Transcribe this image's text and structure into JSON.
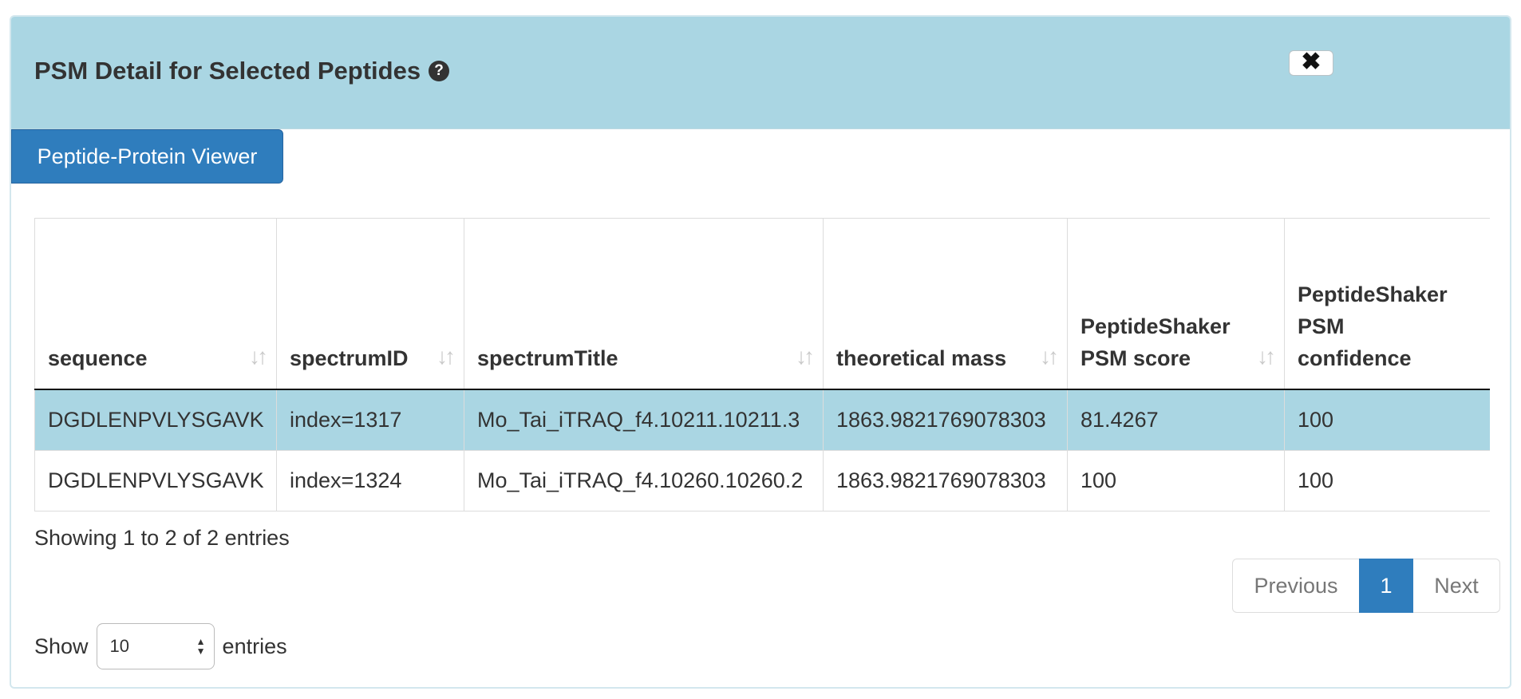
{
  "panel": {
    "title": "PSM Detail for Selected Peptides",
    "help_icon": "?",
    "close_icon": "✖"
  },
  "viewer_button": {
    "label": "Peptide-Protein Viewer"
  },
  "table": {
    "columns": [
      "sequence",
      "spectrumID",
      "spectrumTitle",
      "theoretical mass",
      "PeptideShaker PSM score",
      "PeptideShaker PSM confidence"
    ],
    "sort_icon": "↓↑",
    "rows": [
      [
        "DGDLENPVLYSGAVK",
        "index=1317",
        "Mo_Tai_iTRAQ_f4.10211.10211.3",
        "1863.9821769078303",
        "81.4267",
        "100"
      ],
      [
        "DGDLENPVLYSGAVK",
        "index=1324",
        "Mo_Tai_iTRAQ_f4.10260.10260.2",
        "1863.9821769078303",
        "100",
        "100"
      ]
    ],
    "selected_row": 0
  },
  "info": "Showing 1 to 2 of 2 entries",
  "pagination": {
    "previous": "Previous",
    "current": "1",
    "next": "Next"
  },
  "length": {
    "show": "Show",
    "value": "10",
    "entries": "entries"
  },
  "colors": {
    "header_bg": "#aad6e3",
    "primary": "#2f7dbd",
    "selected_row": "#aad6e3"
  }
}
